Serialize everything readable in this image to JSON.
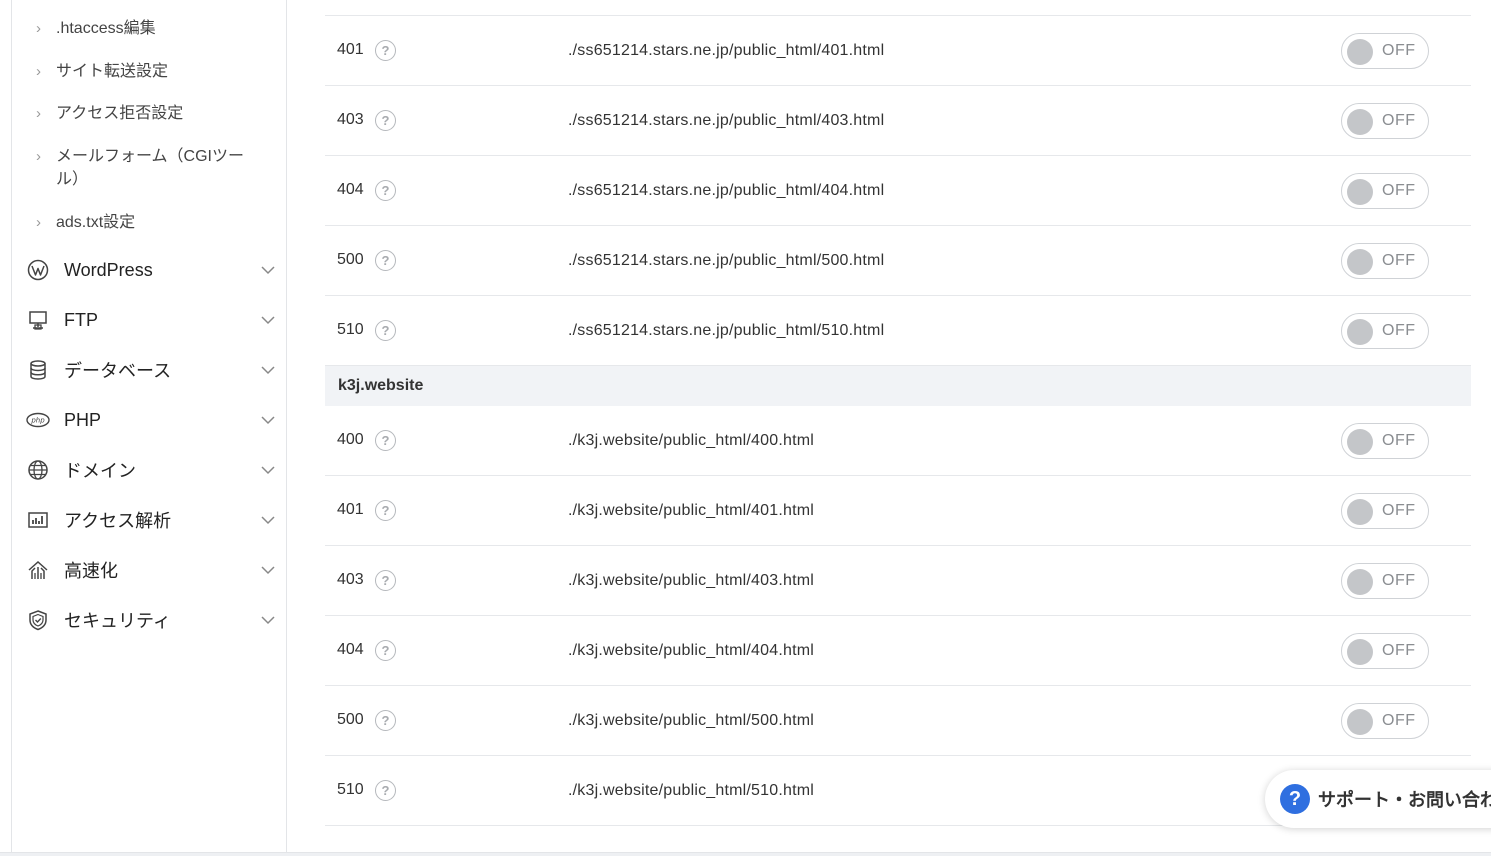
{
  "sidebar": {
    "sub_items": [
      {
        "label": ".htaccess編集"
      },
      {
        "label": "サイト転送設定"
      },
      {
        "label": "アクセス拒否設定"
      },
      {
        "label": "メールフォーム（CGIツール）"
      },
      {
        "label": "ads.txt設定"
      }
    ],
    "menu_items": [
      {
        "label": "WordPress",
        "icon": "wordpress-icon"
      },
      {
        "label": "FTP",
        "icon": "ftp-icon"
      },
      {
        "label": "データベース",
        "icon": "database-icon"
      },
      {
        "label": "PHP",
        "icon": "php-icon"
      },
      {
        "label": "ドメイン",
        "icon": "globe-icon"
      },
      {
        "label": "アクセス解析",
        "icon": "analytics-icon"
      },
      {
        "label": "高速化",
        "icon": "speed-icon"
      },
      {
        "label": "セキュリティ",
        "icon": "shield-icon"
      }
    ]
  },
  "help_glyph": "?",
  "toggle_off_label": "OFF",
  "domain1_rows": [
    {
      "code": "401",
      "path": "./ss651214.stars.ne.jp/public_html/401.html"
    },
    {
      "code": "403",
      "path": "./ss651214.stars.ne.jp/public_html/403.html"
    },
    {
      "code": "404",
      "path": "./ss651214.stars.ne.jp/public_html/404.html"
    },
    {
      "code": "500",
      "path": "./ss651214.stars.ne.jp/public_html/500.html"
    },
    {
      "code": "510",
      "path": "./ss651214.stars.ne.jp/public_html/510.html"
    }
  ],
  "domain2": {
    "name": "k3j.website",
    "rows": [
      {
        "code": "400",
        "path": "./k3j.website/public_html/400.html"
      },
      {
        "code": "401",
        "path": "./k3j.website/public_html/401.html"
      },
      {
        "code": "403",
        "path": "./k3j.website/public_html/403.html"
      },
      {
        "code": "404",
        "path": "./k3j.website/public_html/404.html"
      },
      {
        "code": "500",
        "path": "./k3j.website/public_html/500.html"
      },
      {
        "code": "510",
        "path": "./k3j.website/public_html/510.html"
      }
    ]
  },
  "support": {
    "label": "サポート・お問い合わせ"
  },
  "colors": {
    "accent": "#2f6fe0",
    "toggle_knob": "#c4c6c9",
    "group_bg": "#f1f3f6"
  }
}
